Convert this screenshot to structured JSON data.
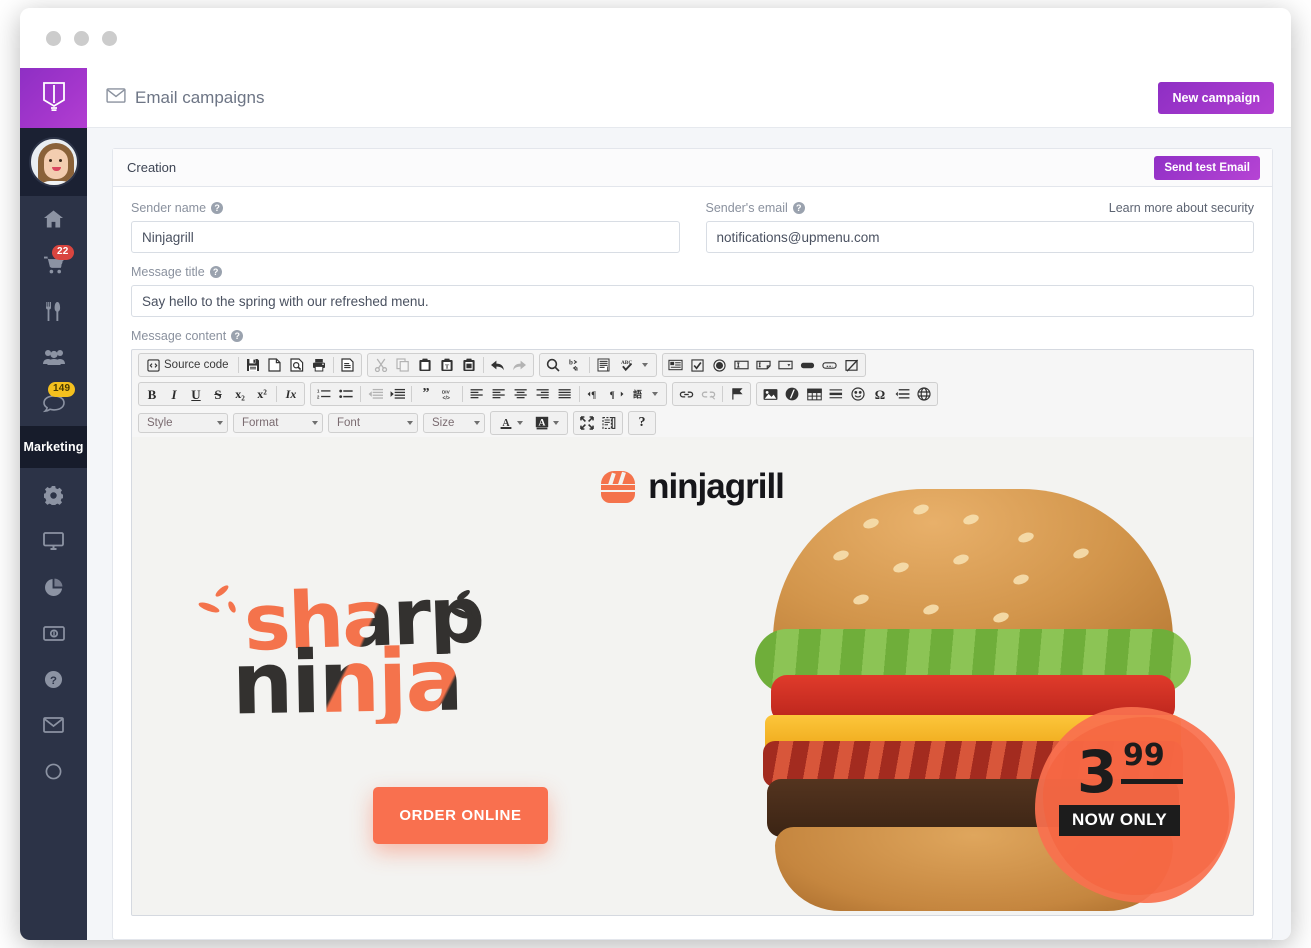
{
  "window": {
    "dots": [
      "close",
      "minimize",
      "maximize"
    ]
  },
  "sidebar": {
    "brand_icon": "book-logo-icon",
    "avatar_name": "user-avatar",
    "items": [
      {
        "icon": "home-icon",
        "name": "home",
        "badge": ""
      },
      {
        "icon": "shopping-cart-icon",
        "name": "orders",
        "badge": "22"
      },
      {
        "icon": "cutlery-icon",
        "name": "menu",
        "badge": ""
      },
      {
        "icon": "users-icon",
        "name": "customers",
        "badge": ""
      },
      {
        "icon": "chat-bubble-icon",
        "name": "messages",
        "badge": "149"
      }
    ],
    "section_label": "Marketing",
    "items_lower": [
      {
        "icon": "gear-icon",
        "name": "settings"
      },
      {
        "icon": "monitor-icon",
        "name": "website"
      },
      {
        "icon": "pie-chart-icon",
        "name": "statistics"
      },
      {
        "icon": "banknote-icon",
        "name": "payments"
      },
      {
        "icon": "question-circle-icon",
        "name": "help"
      },
      {
        "icon": "envelope-icon",
        "name": "email"
      },
      {
        "icon": "circle-icon",
        "name": "status"
      }
    ]
  },
  "topbar": {
    "icon": "envelope-icon",
    "title": "Email campaigns",
    "new_campaign_label": "New campaign"
  },
  "card": {
    "title": "Creation",
    "send_test_label": "Send test Email"
  },
  "form": {
    "sender_name": {
      "label": "Sender name",
      "value": "Ninjagrill",
      "placeholder": "Sender name"
    },
    "sender_email": {
      "label": "Sender's email",
      "value": "notifications@upmenu.com",
      "placeholder": "Sender's email"
    },
    "security_link": "Learn more about security",
    "message_title": {
      "label": "Message title",
      "value": "Say hello to the spring with our refreshed menu.",
      "placeholder": "Message title"
    },
    "message_content": {
      "label": "Message content"
    },
    "help_glyph": "?"
  },
  "editor": {
    "row1": [
      {
        "group": 1,
        "icons": [
          "source-code-icon"
        ],
        "label": "Source code",
        "name": "source-code",
        "disabled": false
      },
      {
        "group": 1,
        "icons": [
          "save-icon"
        ],
        "name": "save",
        "disabled": false
      },
      {
        "group": 1,
        "icons": [
          "new-page-icon"
        ],
        "name": "new-page",
        "disabled": false
      },
      {
        "group": 1,
        "icons": [
          "preview-icon"
        ],
        "name": "preview",
        "disabled": false
      },
      {
        "group": 1,
        "icons": [
          "print-icon"
        ],
        "name": "print",
        "disabled": false
      },
      {
        "group": 1,
        "icons": [
          "templates-icon"
        ],
        "name": "templates",
        "disabled": false
      },
      {
        "group": 2,
        "icons": [
          "cut-icon"
        ],
        "name": "cut",
        "disabled": true
      },
      {
        "group": 2,
        "icons": [
          "copy-icon"
        ],
        "name": "copy",
        "disabled": true
      },
      {
        "group": 2,
        "icons": [
          "paste-icon"
        ],
        "name": "paste",
        "disabled": false
      },
      {
        "group": 2,
        "icons": [
          "paste-text-icon"
        ],
        "name": "paste-as-plain-text",
        "disabled": false
      },
      {
        "group": 2,
        "icons": [
          "paste-word-icon"
        ],
        "name": "paste-from-word",
        "disabled": false
      },
      {
        "group": 2,
        "icons": [
          "undo-icon"
        ],
        "name": "undo",
        "disabled": false
      },
      {
        "group": 2,
        "icons": [
          "redo-icon"
        ],
        "name": "redo",
        "disabled": true
      },
      {
        "group": 3,
        "icons": [
          "find-icon"
        ],
        "name": "find",
        "disabled": false
      },
      {
        "group": 3,
        "icons": [
          "replace-icon"
        ],
        "name": "replace",
        "disabled": false
      },
      {
        "group": 3,
        "icons": [
          "select-all-icon"
        ],
        "name": "select-all",
        "disabled": false
      },
      {
        "group": 3,
        "icons": [
          "spellcheck-icon"
        ],
        "name": "spell-check",
        "disabled": false
      },
      {
        "group": 4,
        "icons": [
          "form-icon"
        ],
        "name": "form",
        "disabled": false
      },
      {
        "group": 4,
        "icons": [
          "checkbox-icon"
        ],
        "name": "checkbox",
        "disabled": false
      },
      {
        "group": 4,
        "icons": [
          "radio-button-icon"
        ],
        "name": "radio-button",
        "disabled": false
      },
      {
        "group": 4,
        "icons": [
          "text-field-icon"
        ],
        "name": "text-field",
        "disabled": false
      },
      {
        "group": 4,
        "icons": [
          "textarea-icon"
        ],
        "name": "textarea",
        "disabled": false
      },
      {
        "group": 4,
        "icons": [
          "select-field-icon"
        ],
        "name": "selection-field",
        "disabled": false
      },
      {
        "group": 4,
        "icons": [
          "button-icon"
        ],
        "name": "button",
        "disabled": false
      },
      {
        "group": 4,
        "icons": [
          "image-button-icon"
        ],
        "name": "image-button",
        "disabled": false
      },
      {
        "group": 4,
        "icons": [
          "hidden-field-icon"
        ],
        "name": "hidden-field",
        "disabled": false
      }
    ],
    "row2": [
      {
        "group": 1,
        "text": "B",
        "name": "bold",
        "disabled": false
      },
      {
        "group": 1,
        "text": "I",
        "name": "italic",
        "disabled": false
      },
      {
        "group": 1,
        "text": "U",
        "name": "underline",
        "disabled": false
      },
      {
        "group": 1,
        "text": "S",
        "name": "strikethrough",
        "disabled": false
      },
      {
        "group": 1,
        "text": "x₂",
        "name": "subscript",
        "disabled": false
      },
      {
        "group": 1,
        "text": "x²",
        "name": "superscript",
        "disabled": false
      },
      {
        "group": 1,
        "text": "Ix",
        "name": "remove-format",
        "disabled": false
      },
      {
        "group": 2,
        "icons": [
          "numbered-list-icon"
        ],
        "name": "numbered-list",
        "disabled": false
      },
      {
        "group": 2,
        "icons": [
          "bulleted-list-icon"
        ],
        "name": "bulleted-list",
        "disabled": false
      },
      {
        "group": 2,
        "icons": [
          "decrease-indent-icon"
        ],
        "name": "decrease-indent",
        "disabled": true
      },
      {
        "group": 2,
        "icons": [
          "increase-indent-icon"
        ],
        "name": "increase-indent",
        "disabled": false
      },
      {
        "group": 2,
        "icons": [
          "blockquote-icon"
        ],
        "name": "blockquote",
        "disabled": false
      },
      {
        "group": 2,
        "icons": [
          "div-container-icon"
        ],
        "name": "create-div-container",
        "disabled": false
      },
      {
        "group": 2,
        "icons": [
          "align-left-icon"
        ],
        "name": "align-left",
        "disabled": false
      },
      {
        "group": 2,
        "icons": [
          "align-left2-icon"
        ],
        "name": "align-left-2",
        "disabled": false
      },
      {
        "group": 2,
        "icons": [
          "align-center-icon"
        ],
        "name": "align-center",
        "disabled": false
      },
      {
        "group": 2,
        "icons": [
          "align-right-icon"
        ],
        "name": "align-right",
        "disabled": false
      },
      {
        "group": 2,
        "icons": [
          "justify-icon"
        ],
        "name": "justify",
        "disabled": false
      },
      {
        "group": 2,
        "icons": [
          "ltr-icon"
        ],
        "name": "text-direction-ltr",
        "disabled": false
      },
      {
        "group": 2,
        "icons": [
          "rtl-icon"
        ],
        "name": "text-direction-rtl",
        "disabled": false
      },
      {
        "group": 2,
        "icons": [
          "language-icon"
        ],
        "name": "set-language",
        "disabled": false
      },
      {
        "group": 3,
        "icons": [
          "link-icon"
        ],
        "name": "link",
        "disabled": false
      },
      {
        "group": 3,
        "icons": [
          "unlink-icon"
        ],
        "name": "unlink",
        "disabled": true
      },
      {
        "group": 3,
        "icons": [
          "anchor-flag-icon"
        ],
        "name": "anchor",
        "disabled": false
      },
      {
        "group": 4,
        "icons": [
          "image-icon"
        ],
        "name": "image",
        "disabled": false
      },
      {
        "group": 4,
        "icons": [
          "flash-icon"
        ],
        "name": "flash",
        "disabled": false
      },
      {
        "group": 4,
        "icons": [
          "table-icon"
        ],
        "name": "table",
        "disabled": false
      },
      {
        "group": 4,
        "icons": [
          "horizontal-rule-icon"
        ],
        "name": "horizontal-rule",
        "disabled": false
      },
      {
        "group": 4,
        "icons": [
          "smiley-icon"
        ],
        "name": "smiley",
        "disabled": false
      },
      {
        "group": 4,
        "icons": [
          "special-char-icon"
        ],
        "name": "special-character",
        "disabled": false
      },
      {
        "group": 4,
        "icons": [
          "page-break-icon"
        ],
        "name": "page-break",
        "disabled": false
      },
      {
        "group": 4,
        "icons": [
          "iframe-icon"
        ],
        "name": "iframe",
        "disabled": false
      }
    ],
    "combos": [
      {
        "label": "Style",
        "name": "style-dropdown"
      },
      {
        "label": "Format",
        "name": "format-dropdown"
      },
      {
        "label": "Font",
        "name": "font-dropdown"
      },
      {
        "label": "Size",
        "name": "size-dropdown"
      }
    ],
    "row3_buttons": [
      {
        "icon": "text-color-icon",
        "name": "text-color"
      },
      {
        "icon": "background-color-icon",
        "name": "background-color"
      },
      {
        "icon": "maximize-icon",
        "name": "maximize"
      },
      {
        "icon": "show-blocks-icon",
        "name": "show-blocks"
      },
      {
        "icon": "help-icon",
        "name": "about",
        "text": "?"
      }
    ]
  },
  "preview": {
    "logo_text": "ninjagrill",
    "logo_icon": "burger-icon",
    "headline_line1": "sharp",
    "headline_line2": "ninja",
    "cta_label": "ORDER ONLINE",
    "price_main": "3",
    "price_cents": "99",
    "price_caption": "NOW ONLY",
    "hero_image": "bacon-cheeseburger-photo"
  },
  "colors": {
    "brand_purple": "#a436cc",
    "sidebar_dark": "#2c3347",
    "accent_orange": "#f9704f",
    "badge_red": "#d9453f",
    "badge_yellow": "#f4c01e"
  }
}
